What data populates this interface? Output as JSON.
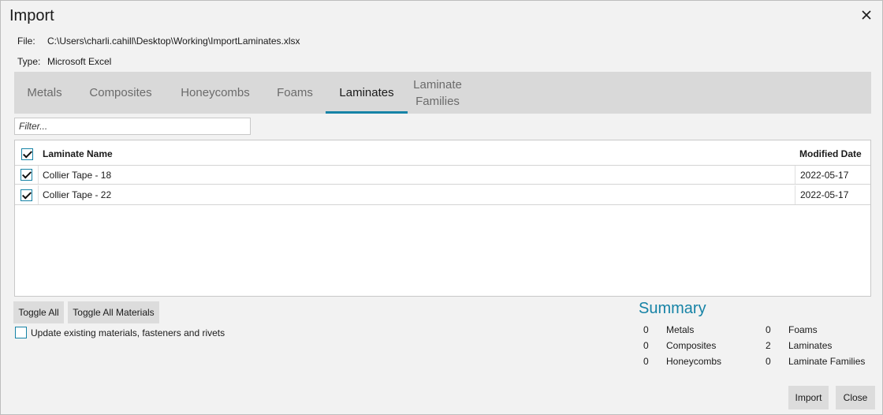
{
  "window": {
    "title": "Import"
  },
  "meta": {
    "file_label": "File:",
    "file_value": "C:\\Users\\charli.cahill\\Desktop\\Working\\ImportLaminates.xlsx",
    "type_label": "Type:",
    "type_value": "Microsoft Excel"
  },
  "tabs": [
    {
      "label": "Metals"
    },
    {
      "label": "Composites"
    },
    {
      "label": "Honeycombs"
    },
    {
      "label": "Foams"
    },
    {
      "label": "Laminates",
      "active": true
    },
    {
      "label": "Laminate Families"
    }
  ],
  "filter": {
    "placeholder": "Filter..."
  },
  "grid": {
    "columns": {
      "name": "Laminate Name",
      "date": "Modified Date"
    },
    "header_checked": true,
    "rows": [
      {
        "name": "Collier Tape - 18",
        "date": "2022-05-17",
        "checked": true
      },
      {
        "name": "Collier Tape - 22",
        "date": "2022-05-17",
        "checked": true
      }
    ]
  },
  "buttons": {
    "toggle_all": "Toggle All",
    "toggle_all_materials": "Toggle All Materials",
    "import": "Import",
    "close": "Close"
  },
  "update_option": {
    "label": "Update existing materials, fasteners and rivets",
    "checked": false
  },
  "summary": {
    "title": "Summary",
    "items": [
      {
        "count": "0",
        "label": "Metals"
      },
      {
        "count": "0",
        "label": "Composites"
      },
      {
        "count": "0",
        "label": "Honeycombs"
      },
      {
        "count": "0",
        "label": "Foams"
      },
      {
        "count": "2",
        "label": "Laminates"
      },
      {
        "count": "0",
        "label": "Laminate Families"
      }
    ]
  },
  "colors": {
    "accent": "#1683a6",
    "tabbar": "#d9d9d9",
    "background": "#f2f2f2"
  },
  "icons": {
    "close": "close-icon",
    "checkbox": "checkbox"
  }
}
